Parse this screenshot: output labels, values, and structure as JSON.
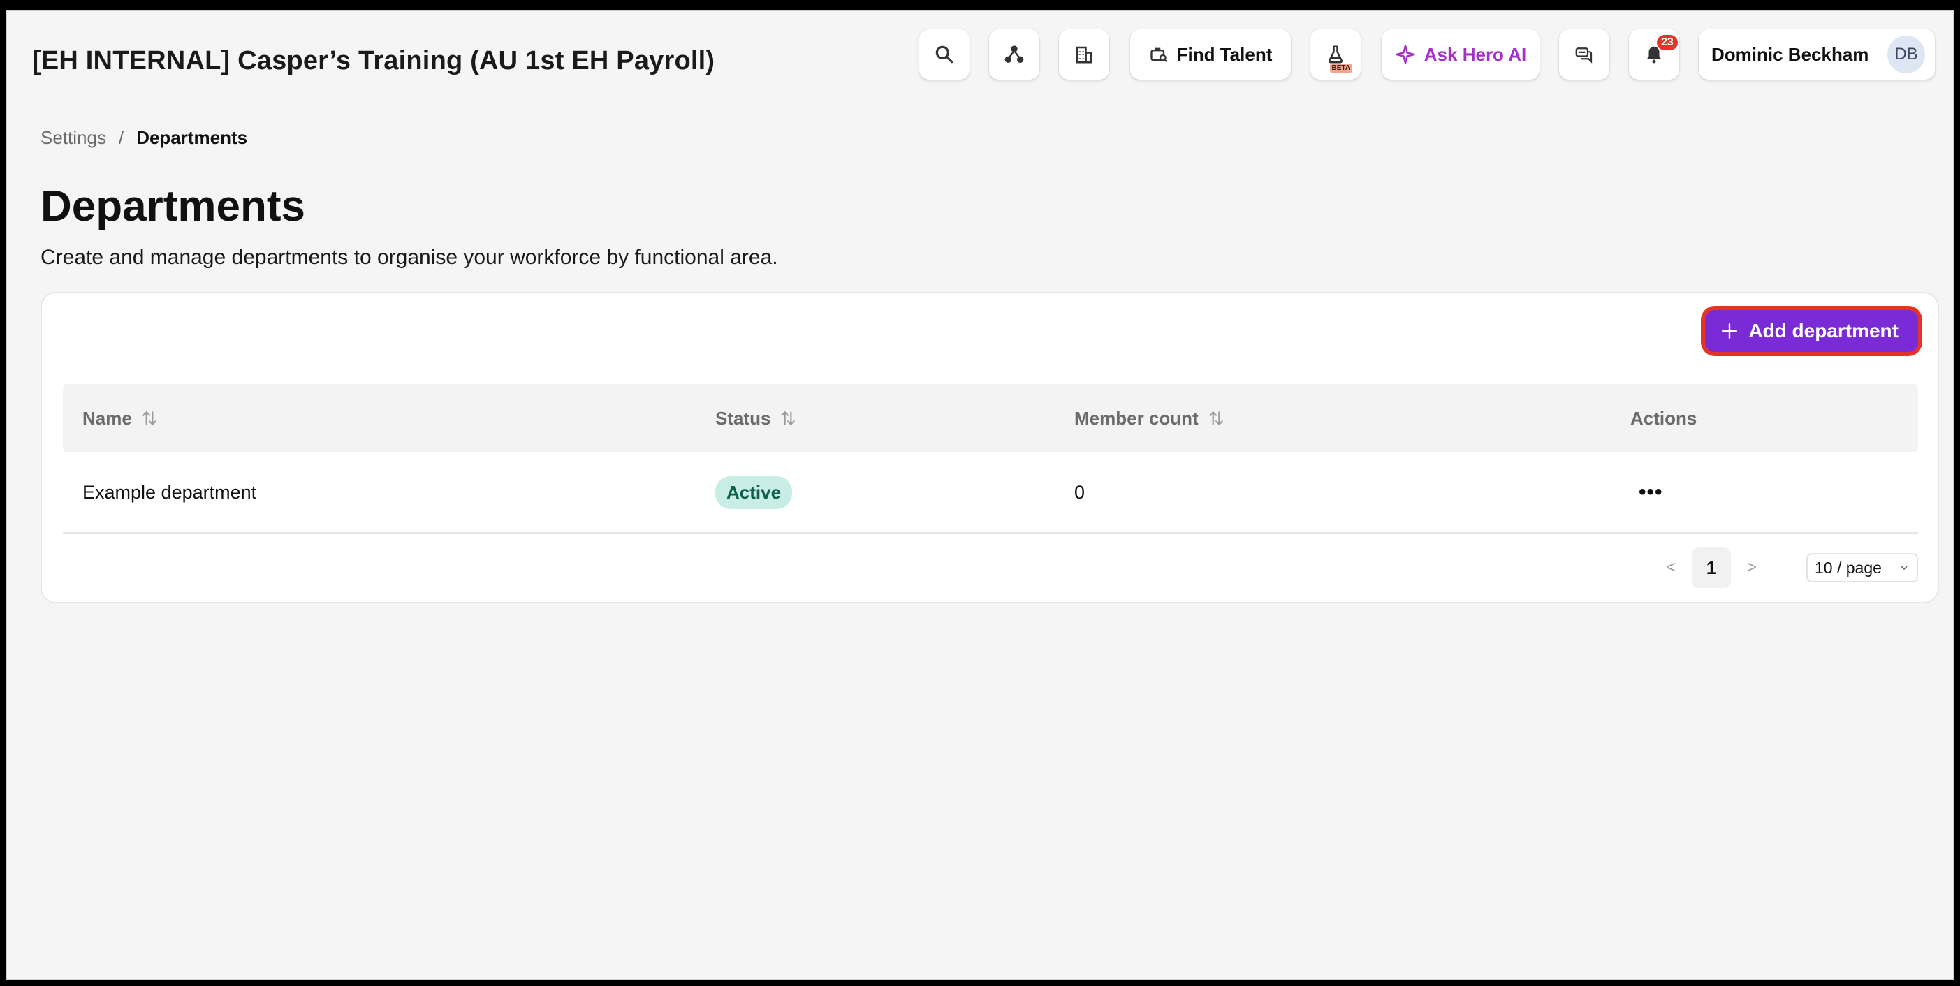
{
  "header": {
    "org_title": "[EH INTERNAL] Casper’s Training (AU 1st EH Payroll)",
    "find_talent_label": "Find Talent",
    "beta_label": "BETA",
    "ask_ai_label": "Ask Hero AI",
    "notification_count": "23",
    "user_name": "Dominic Beckham",
    "user_initials": "DB",
    "icons": [
      "search-icon",
      "network-icon",
      "building-icon",
      "briefcase-search-icon",
      "flask-icon",
      "sparkle-icon",
      "chat-icon",
      "bell-icon"
    ]
  },
  "breadcrumb": {
    "parent": "Settings",
    "separator": "/",
    "current": "Departments"
  },
  "page": {
    "title": "Departments",
    "description": "Create and manage departments to organise your workforce by functional area."
  },
  "actions": {
    "add_department_label": "Add department"
  },
  "table": {
    "columns": [
      {
        "label": "Name",
        "sortable": true
      },
      {
        "label": "Status",
        "sortable": true
      },
      {
        "label": "Member count",
        "sortable": true
      },
      {
        "label": "Actions",
        "sortable": false
      }
    ],
    "rows": [
      {
        "name": "Example department",
        "status": "Active",
        "member_count": "0",
        "actions": "•••"
      }
    ]
  },
  "pagination": {
    "prev": "<",
    "current_page": "1",
    "next": ">",
    "page_size": "10 / page"
  },
  "colors": {
    "accent": "#7a2bd6",
    "highlight_border": "#e5332a",
    "status_active_bg": "#c8ede4",
    "ai_accent": "#a62fc9"
  }
}
